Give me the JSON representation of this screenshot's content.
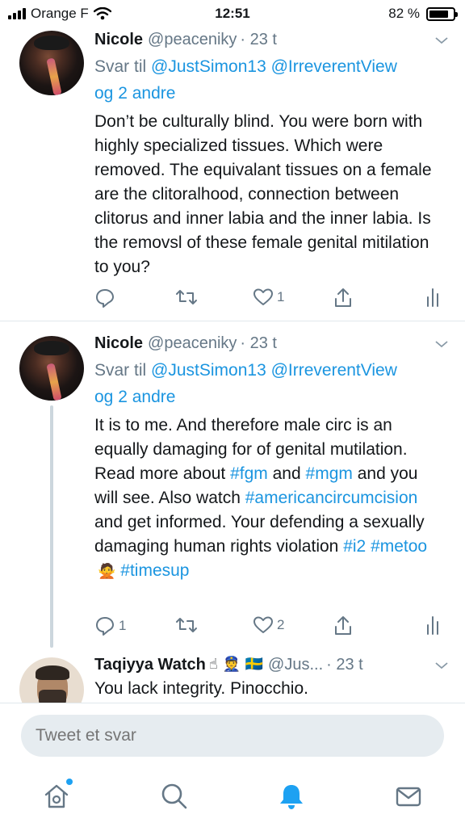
{
  "status_bar": {
    "carrier": "Orange F",
    "time": "12:51",
    "battery": "82 %",
    "battery_level": 0.82
  },
  "tweets": [
    {
      "name": "Nicole",
      "handle": "@peaceniky",
      "time": "· 23 t",
      "reply_prefix": "Svar til",
      "reply_mentions": "@JustSimon13 @IrreverentView",
      "reply_others": "og 2 andre",
      "text": "Don’t be culturally blind. You were born with highly specialized tissues. Which were removed. The equivalant tissues on a female are the clitoralhood, connection between clitorus and inner labia and the inner labia. Is the removsl of these female genital mitilation to you?",
      "reply_count": "",
      "like_count": "1"
    },
    {
      "name": "Nicole",
      "handle": "@peaceniky",
      "time": "· 23 t",
      "reply_prefix": "Svar til",
      "reply_mentions": "@JustSimon13 @IrreverentView",
      "reply_others": "og 2 andre",
      "text_parts": {
        "p1": "It is to me. And therefore male circ is an equally damaging for of genital mutilation. Read more about ",
        "tag1": "#fgm",
        "p2": " and ",
        "tag2": "#mgm",
        "p3": " and you will see. Also watch ",
        "tag3": "#americancircumcision",
        "p4": " and get informed. Your defending a sexually damaging human rights violation ",
        "tag4": "#i2",
        "tag5": "#metoo",
        "emoji": "🙅",
        "tag6": "#timesup"
      },
      "reply_count": "1",
      "like_count": "2"
    },
    {
      "name": "Taqiyya Watch",
      "emojis": "☝ 👮 🇸🇪",
      "handle": "@Jus...",
      "time": "· 23 t",
      "text": "You lack integrity. Pinocchio."
    }
  ],
  "reply_bar": {
    "placeholder": "Tweet et svar"
  },
  "tabs": [
    "home",
    "search",
    "notifications",
    "messages"
  ],
  "colors": {
    "link": "#1b95e0",
    "accent": "#1da1f2",
    "muted": "#657786"
  }
}
